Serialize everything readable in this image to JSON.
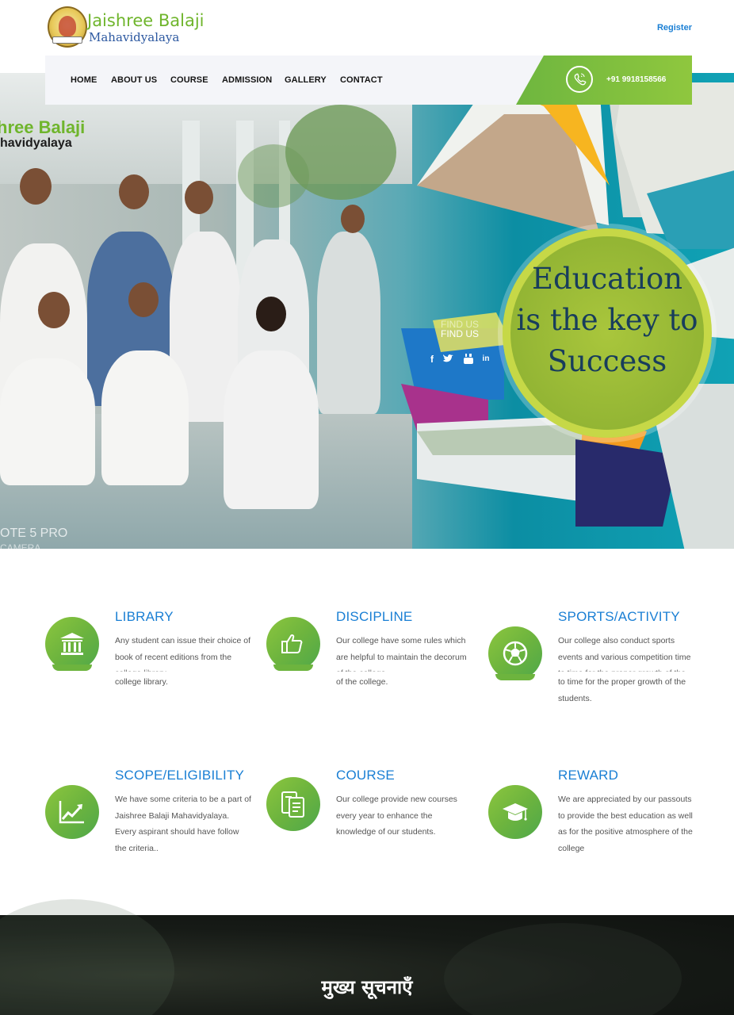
{
  "header": {
    "logo_title": "Jaishree Balaji",
    "logo_subtitle": "Mahavidyalaya",
    "register_label": "Register"
  },
  "nav": {
    "items": [
      "HOME",
      "ABOUT US",
      "COURSE",
      "ADMISSION",
      "GALLERY",
      "CONTACT"
    ],
    "phone": "+91 9918158566"
  },
  "hero": {
    "tagline_1": "hree Balaji",
    "tagline_2": "havidyalaya",
    "slogan_line_1": "Education",
    "slogan_line_2": "is the key to",
    "slogan_line_3": "Success",
    "find_us": "FIND US",
    "watermark_1": "OTE 5 PRO",
    "watermark_2": "CAMERA",
    "social_icons": [
      "facebook-icon",
      "twitter-icon",
      "youtube-icon",
      "linkedin-icon"
    ]
  },
  "features": [
    {
      "title": "LIBRARY",
      "icon": "library-building-icon",
      "text": "Any student can issue their choice of book of recent editions from the",
      "cut": "college library",
      "tail": "college library."
    },
    {
      "title": "DISCIPLINE",
      "icon": "thumbs-up-icon",
      "text": "Our college have some rules which are helpful to maintain the decorum",
      "cut": "of the college",
      "tail": "of the college."
    },
    {
      "title": "SPORTS/ACTIVITY",
      "icon": "football-icon",
      "text": "Our college also conduct sports events and various competition time",
      "cut": "to time for the proper growth of the",
      "tail": "to time for the proper growth of the students."
    },
    {
      "title": "SCOPE/ELIGIBILITY",
      "icon": "growth-chart-icon",
      "text": "We have some criteria to be a part of Jaishree Balaji Mahavidyalaya. Every aspirant should have follow the criteria..",
      "cut": "",
      "tail": ""
    },
    {
      "title": "COURSE",
      "icon": "books-icon",
      "text": "Our college provide new courses every year to enhance the knowledge of our students.",
      "cut": "",
      "tail": ""
    },
    {
      "title": "REWARD",
      "icon": "graduation-cap-icon",
      "text": "We are appreciated by our passouts to provide the best education as well as for the positive atmosphere of the college",
      "cut": "",
      "tail": ""
    }
  ],
  "notices": {
    "title": "मुख्य सूचनाएँ"
  },
  "colors": {
    "brand_green": "#6fb52c",
    "accent_blue": "#1a7fd4",
    "slogan_text": "#183d5c"
  }
}
